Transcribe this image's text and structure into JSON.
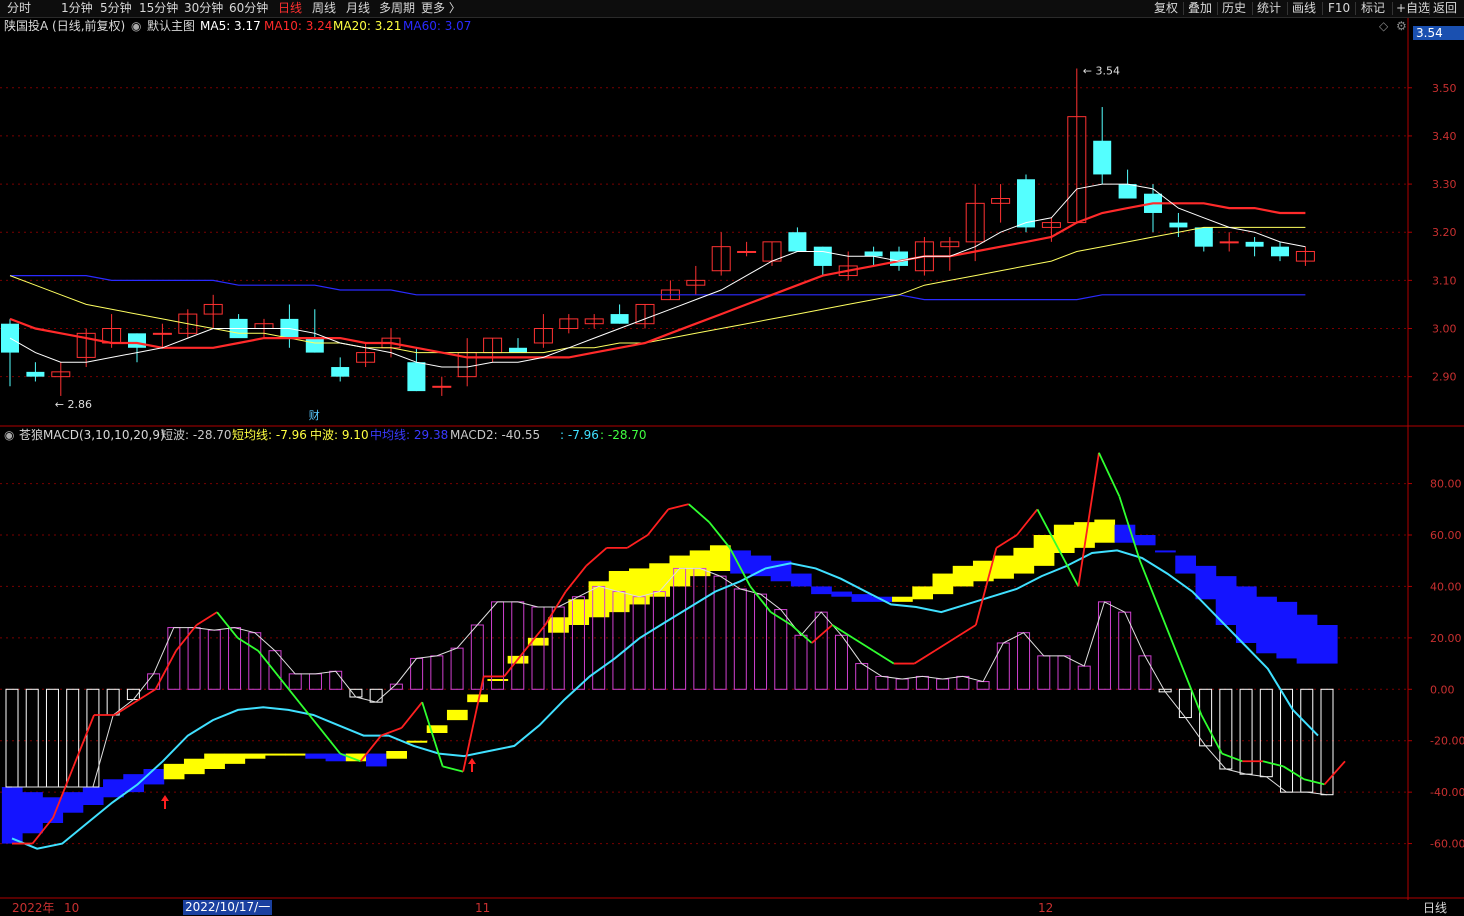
{
  "toolbar": {
    "periods": [
      "分时",
      "1分钟",
      "5分钟",
      "15分钟",
      "30分钟",
      "60分钟",
      "日线",
      "周线",
      "月线",
      "多周期",
      "更多 〉"
    ],
    "active_index": 6,
    "actions": [
      "复权",
      "叠加",
      "历史",
      "统计",
      "画线",
      "F10",
      "标记",
      "+自选",
      "返回"
    ]
  },
  "main_panel": {
    "title": "陕国投A (日线,前复权)",
    "template": "默认主图",
    "ma": [
      {
        "label": "MA5: 3.17",
        "color": "#ffffff"
      },
      {
        "label": "MA10: 3.24",
        "color": "#ff2a2a"
      },
      {
        "label": "MA20: 3.21",
        "color": "#ffff40"
      },
      {
        "label": "MA60: 3.07",
        "color": "#2a2aff"
      }
    ],
    "price_tag": "3.54",
    "y_ticks": [
      "3.50",
      "3.40",
      "3.30",
      "3.20",
      "3.10",
      "3.00",
      "2.90"
    ],
    "high_label": "3.54",
    "low_label": "2.86",
    "marker": "财"
  },
  "indicator_panel": {
    "name": "苍狼MACD(3,10,10,20,9)",
    "fields": [
      {
        "text": "短波: -28.70",
        "color": "#c8c8c8"
      },
      {
        "text": "短均线: -7.96",
        "color": "#ffff40"
      },
      {
        "text": "中波: 9.10",
        "color": "#ffff40"
      },
      {
        "text": "中均线: 29.38",
        "color": "#3a3aff"
      },
      {
        "text": "MACD2: -40.55",
        "color": "#c8c8c8"
      },
      {
        "text": ": -7.96",
        "color": "#40e0ff"
      },
      {
        "text": ": -28.70",
        "color": "#40ff40"
      }
    ],
    "y_ticks": [
      "80.00",
      "60.00",
      "40.00",
      "20.00",
      "0.00",
      "-20.00",
      "-40.00",
      "-60.00"
    ]
  },
  "x_axis": {
    "labels": [
      "2022年",
      "10",
      "2022/10/17/一",
      "11",
      "12"
    ],
    "period_label": "日线"
  },
  "colors": {
    "up": "#ff3232",
    "down": "#54ffff",
    "grid": "#7a0000",
    "axis": "#b00000"
  },
  "chart_data": [
    {
      "type": "candlestick",
      "title": "陕国投A (日线,前复权)",
      "ylim": [
        2.81,
        3.62
      ],
      "candles": [
        [
          3.01,
          3.02,
          2.88,
          2.95
        ],
        [
          2.91,
          2.93,
          2.89,
          2.9
        ],
        [
          2.9,
          2.93,
          2.86,
          2.91
        ],
        [
          2.94,
          3.0,
          2.92,
          2.99
        ],
        [
          2.97,
          3.03,
          2.96,
          3.0
        ],
        [
          2.99,
          2.99,
          2.93,
          2.96
        ],
        [
          2.99,
          3.01,
          2.96,
          2.99
        ],
        [
          2.99,
          3.04,
          2.98,
          3.03
        ],
        [
          3.03,
          3.07,
          3.0,
          3.05
        ],
        [
          3.02,
          3.03,
          2.99,
          2.98
        ],
        [
          3.0,
          3.02,
          2.98,
          3.01
        ],
        [
          3.02,
          3.05,
          2.96,
          2.98
        ],
        [
          2.98,
          3.04,
          2.95,
          2.95
        ],
        [
          2.92,
          2.94,
          2.89,
          2.9
        ],
        [
          2.93,
          2.97,
          2.92,
          2.95
        ],
        [
          2.96,
          3.0,
          2.94,
          2.98
        ],
        [
          2.93,
          2.96,
          2.87,
          2.87
        ],
        [
          2.88,
          2.9,
          2.86,
          2.88
        ],
        [
          2.9,
          2.98,
          2.88,
          2.95
        ],
        [
          2.95,
          2.98,
          2.93,
          2.98
        ],
        [
          2.96,
          2.98,
          2.95,
          2.95
        ],
        [
          2.97,
          3.03,
          2.96,
          3.0
        ],
        [
          3.0,
          3.03,
          2.99,
          3.02
        ],
        [
          3.01,
          3.03,
          3.0,
          3.02
        ],
        [
          3.03,
          3.05,
          3.01,
          3.01
        ],
        [
          3.01,
          3.05,
          3.0,
          3.05
        ],
        [
          3.06,
          3.1,
          3.06,
          3.08
        ],
        [
          3.09,
          3.13,
          3.07,
          3.1
        ],
        [
          3.12,
          3.2,
          3.11,
          3.17
        ],
        [
          3.16,
          3.18,
          3.15,
          3.16
        ],
        [
          3.14,
          3.18,
          3.13,
          3.18
        ],
        [
          3.2,
          3.21,
          3.17,
          3.16
        ],
        [
          3.17,
          3.17,
          3.11,
          3.13
        ],
        [
          3.11,
          3.16,
          3.1,
          3.13
        ],
        [
          3.16,
          3.17,
          3.13,
          3.15
        ],
        [
          3.16,
          3.17,
          3.12,
          3.13
        ],
        [
          3.12,
          3.19,
          3.11,
          3.18
        ],
        [
          3.17,
          3.19,
          3.12,
          3.18
        ],
        [
          3.18,
          3.3,
          3.14,
          3.26
        ],
        [
          3.26,
          3.3,
          3.22,
          3.27
        ],
        [
          3.31,
          3.32,
          3.2,
          3.21
        ],
        [
          3.21,
          3.23,
          3.18,
          3.22
        ],
        [
          3.22,
          3.54,
          3.22,
          3.44
        ],
        [
          3.39,
          3.46,
          3.3,
          3.32
        ],
        [
          3.3,
          3.33,
          3.27,
          3.27
        ],
        [
          3.28,
          3.3,
          3.2,
          3.24
        ],
        [
          3.22,
          3.24,
          3.19,
          3.21
        ],
        [
          3.21,
          3.21,
          3.16,
          3.17
        ],
        [
          3.18,
          3.2,
          3.16,
          3.18
        ],
        [
          3.18,
          3.19,
          3.15,
          3.17
        ],
        [
          3.17,
          3.18,
          3.14,
          3.15
        ],
        [
          3.14,
          3.17,
          3.13,
          3.16
        ]
      ],
      "ma5": [
        2.98,
        2.95,
        2.93,
        2.93,
        2.94,
        2.95,
        2.96,
        2.98,
        3.0,
        3.0,
        3.0,
        3.0,
        2.99,
        2.97,
        2.96,
        2.95,
        2.93,
        2.92,
        2.92,
        2.93,
        2.93,
        2.94,
        2.96,
        2.98,
        3.0,
        3.02,
        3.04,
        3.06,
        3.08,
        3.11,
        3.14,
        3.16,
        3.16,
        3.15,
        3.15,
        3.14,
        3.15,
        3.15,
        3.17,
        3.2,
        3.22,
        3.23,
        3.29,
        3.3,
        3.3,
        3.29,
        3.25,
        3.23,
        3.21,
        3.2,
        3.18,
        3.17
      ],
      "ma10": [
        3.02,
        3.0,
        2.99,
        2.98,
        2.97,
        2.97,
        2.96,
        2.96,
        2.96,
        2.97,
        2.98,
        2.98,
        2.98,
        2.98,
        2.97,
        2.97,
        2.96,
        2.95,
        2.94,
        2.94,
        2.94,
        2.94,
        2.94,
        2.95,
        2.96,
        2.97,
        2.99,
        3.01,
        3.03,
        3.05,
        3.07,
        3.09,
        3.11,
        3.12,
        3.13,
        3.14,
        3.15,
        3.15,
        3.16,
        3.17,
        3.18,
        3.19,
        3.22,
        3.24,
        3.25,
        3.26,
        3.26,
        3.26,
        3.25,
        3.25,
        3.24,
        3.24
      ],
      "ma20": [
        3.11,
        3.09,
        3.07,
        3.05,
        3.04,
        3.03,
        3.02,
        3.01,
        3.0,
        2.99,
        2.99,
        2.98,
        2.97,
        2.97,
        2.96,
        2.96,
        2.95,
        2.95,
        2.95,
        2.95,
        2.95,
        2.95,
        2.96,
        2.96,
        2.97,
        2.97,
        2.98,
        2.99,
        3.0,
        3.01,
        3.02,
        3.03,
        3.04,
        3.05,
        3.06,
        3.07,
        3.09,
        3.1,
        3.11,
        3.12,
        3.13,
        3.14,
        3.16,
        3.17,
        3.18,
        3.19,
        3.2,
        3.21,
        3.21,
        3.21,
        3.21,
        3.21
      ],
      "ma60": [
        3.11,
        3.11,
        3.11,
        3.11,
        3.1,
        3.1,
        3.1,
        3.1,
        3.1,
        3.09,
        3.09,
        3.09,
        3.09,
        3.08,
        3.08,
        3.08,
        3.07,
        3.07,
        3.07,
        3.07,
        3.07,
        3.07,
        3.07,
        3.07,
        3.07,
        3.07,
        3.07,
        3.07,
        3.07,
        3.07,
        3.07,
        3.07,
        3.07,
        3.07,
        3.07,
        3.07,
        3.06,
        3.06,
        3.06,
        3.06,
        3.06,
        3.06,
        3.06,
        3.07,
        3.07,
        3.07,
        3.07,
        3.07,
        3.07,
        3.07,
        3.07,
        3.07
      ]
    },
    {
      "type": "bar",
      "title": "苍狼MACD(3,10,10,20,9)",
      "ylim": [
        -80,
        95
      ],
      "macd2": [
        -38,
        -38,
        -38,
        -38,
        -38,
        -10,
        -4,
        6,
        24,
        24,
        23,
        24,
        22,
        15,
        6,
        6,
        7,
        -3,
        -5,
        2,
        12,
        13,
        16,
        25,
        34,
        34,
        32,
        32,
        36,
        40,
        38,
        36,
        38,
        47,
        47,
        44,
        39,
        37,
        31,
        21,
        30,
        21,
        10,
        5,
        4,
        5,
        4,
        5,
        3,
        18,
        22,
        13,
        13,
        9,
        34,
        30,
        13,
        -1,
        -11,
        -22,
        -31,
        -33,
        -34,
        -40,
        -40,
        -41
      ],
      "short_avg": [
        -45,
        -48,
        -47,
        -45,
        -38,
        -29,
        -29,
        -25,
        -16,
        -10,
        -7,
        -7,
        -8,
        -12,
        -15,
        -23,
        -26,
        -28,
        -29,
        -22,
        -12,
        -7,
        1,
        14,
        18,
        26,
        33,
        39,
        47,
        51,
        50,
        51,
        54,
        60,
        62,
        62,
        53,
        45,
        34,
        31,
        31,
        32,
        32,
        31,
        40,
        47,
        52,
        51,
        40,
        40,
        43,
        58,
        60,
        61,
        52,
        52,
        46,
        53,
        63,
        54,
        55,
        50,
        46,
        40,
        21,
        15,
        8
      ],
      "mid_wave": [
        -45,
        -44,
        -42,
        -40,
        -38,
        -35,
        -33,
        -31,
        -29,
        -27,
        -25,
        -25,
        -25,
        -25,
        -25,
        -25,
        -24,
        -24,
        -24,
        -20,
        -17,
        -12,
        -8,
        -2,
        4,
        10,
        17,
        22,
        25,
        28,
        30,
        33,
        36,
        40,
        44,
        46,
        45,
        44,
        42,
        40,
        37,
        36,
        34,
        34,
        34,
        35,
        37,
        40,
        42,
        43,
        45,
        48,
        53,
        55,
        57,
        57,
        56,
        54,
        52,
        48,
        44,
        40,
        36,
        34,
        29,
        25
      ],
      "short_wave": [
        -60,
        -60,
        -50,
        -30,
        -10,
        -10,
        -5,
        0,
        15,
        25,
        30,
        20,
        15,
        5,
        -5,
        -15,
        -25,
        -28,
        -18,
        -15,
        -5,
        -30,
        -32,
        5,
        5,
        15,
        25,
        38,
        48,
        55,
        55,
        60,
        70,
        72,
        65,
        55,
        40,
        30,
        25,
        18,
        25,
        20,
        15,
        10,
        10,
        15,
        20,
        25,
        55,
        60,
        70,
        55,
        40,
        92,
        75,
        50,
        30,
        10,
        -10,
        -25,
        -28,
        -28,
        -30,
        -35,
        -37,
        -28
      ],
      "short_wave_cyan": [
        -58,
        -62,
        -60,
        -52,
        -44,
        -37,
        -28,
        -18,
        -12,
        -8,
        -7,
        -8,
        -10,
        -14,
        -18,
        -18,
        -22,
        -25,
        -26,
        -24,
        -22,
        -14,
        -4,
        5,
        12,
        20,
        26,
        32,
        38,
        42,
        47,
        49,
        47,
        43,
        38,
        33,
        32,
        30,
        33,
        36,
        39,
        44,
        48,
        53,
        54,
        51,
        45,
        38,
        28,
        18,
        8,
        -8,
        -18
      ],
      "cloud_low": [
        -60,
        -56,
        -52,
        -48,
        -45,
        -42,
        -40,
        -37,
        -35,
        -33,
        -31,
        -29,
        -27,
        -25,
        -25,
        -25,
        -25,
        -25,
        -25,
        -24,
        -20,
        -14,
        -8,
        -2,
        4,
        10,
        17,
        22,
        25,
        28,
        30,
        33,
        36,
        40,
        44,
        46,
        45,
        44,
        42,
        40,
        37,
        36,
        34,
        34,
        34,
        35,
        37,
        40,
        42,
        43,
        45,
        48,
        53,
        55,
        57,
        57,
        56,
        54,
        52,
        48,
        44,
        40,
        36,
        34,
        29,
        25
      ],
      "cloud_high": [
        -38,
        -40,
        -42,
        -40,
        -38,
        -35,
        -33,
        -31,
        -29,
        -27,
        -25,
        -25,
        -25,
        -25,
        -25,
        -27,
        -28,
        -28,
        -30,
        -27,
        -20,
        -17,
        -12,
        -5,
        4,
        13,
        20,
        28,
        35,
        42,
        46,
        47,
        49,
        52,
        54,
        56,
        54,
        52,
        50,
        45,
        40,
        38,
        37,
        36,
        36,
        40,
        45,
        48,
        50,
        52,
        55,
        60,
        64,
        65,
        66,
        64,
        60,
        54,
        45,
        35,
        25,
        18,
        14,
        12,
        10,
        10
      ]
    }
  ]
}
